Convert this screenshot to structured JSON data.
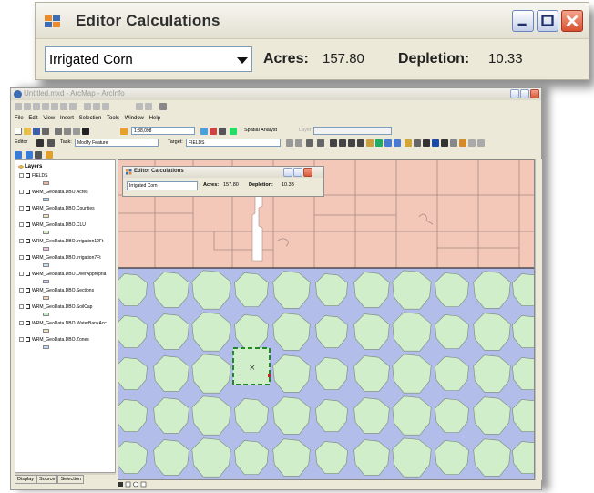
{
  "zoom_window": {
    "title": "Editor Calculations",
    "crop_dropdown": {
      "selected": "Irrigated Corn"
    },
    "acres_label": "Acres:",
    "acres_value": "157.80",
    "depletion_label": "Depletion:",
    "depletion_value": "10.33"
  },
  "arcmap": {
    "title": "Untitled.mxd - ArcMap - ArcInfo",
    "menu": [
      "File",
      "Edit",
      "View",
      "Insert",
      "Selection",
      "Tools",
      "Window",
      "Help"
    ],
    "scale_value": "1:38,098",
    "spatial_analyst_label": "Spatial Analyst",
    "layer_label": "Layer:",
    "editor_label": "Editor",
    "task_label": "Task:",
    "task_value": "Modify Feature",
    "target_label": "Target:",
    "target_value": "FIELDS"
  },
  "toc": {
    "root": "Layers",
    "layers": [
      {
        "name": "FIELDS",
        "color": "#e9b9a7"
      },
      {
        "name": "WRM_GeoData.DBO.Acres",
        "color": "#b8d4ee"
      },
      {
        "name": "WRM_GeoData.DBO.Counties",
        "color": "#f2e6c2"
      },
      {
        "name": "WRM_GeoData.DBO.CLU",
        "color": "#d8ecc0"
      },
      {
        "name": "WRM_GeoData.DBO.Irrigation12Ft",
        "color": "#e8c6df"
      },
      {
        "name": "WRM_GeoData.DBO.Irrigation7Ft",
        "color": "#c9e3f2"
      },
      {
        "name": "WRM_GeoData.DBO.OverAppropria",
        "color": "#d5cff0"
      },
      {
        "name": "WRM_GeoData.DBO.Sections",
        "color": "#f2d7b8"
      },
      {
        "name": "WRM_GeoData.DBO.SoilCap",
        "color": "#c9ecd1"
      },
      {
        "name": "WRM_GeoData.DBO.WaterBankAcc",
        "color": "#f1e4c6"
      },
      {
        "name": "WRM_GeoData.DBO.Zones",
        "color": "#c3d9f1"
      }
    ],
    "tabs": [
      "Display",
      "Source",
      "Selection"
    ]
  },
  "mini_dialog": {
    "title": "Editor Calculations",
    "selected": "Irrigated Corn",
    "acres_label": "Acres:",
    "acres_value": "157.80",
    "depletion_label": "Depletion:",
    "depletion_value": "10.33"
  },
  "colors": {
    "parcel_fill": "#f3c8b9",
    "field_fill": "#cfeec9",
    "water_fill": "#b3bde9",
    "selection": "#1f8a24"
  }
}
